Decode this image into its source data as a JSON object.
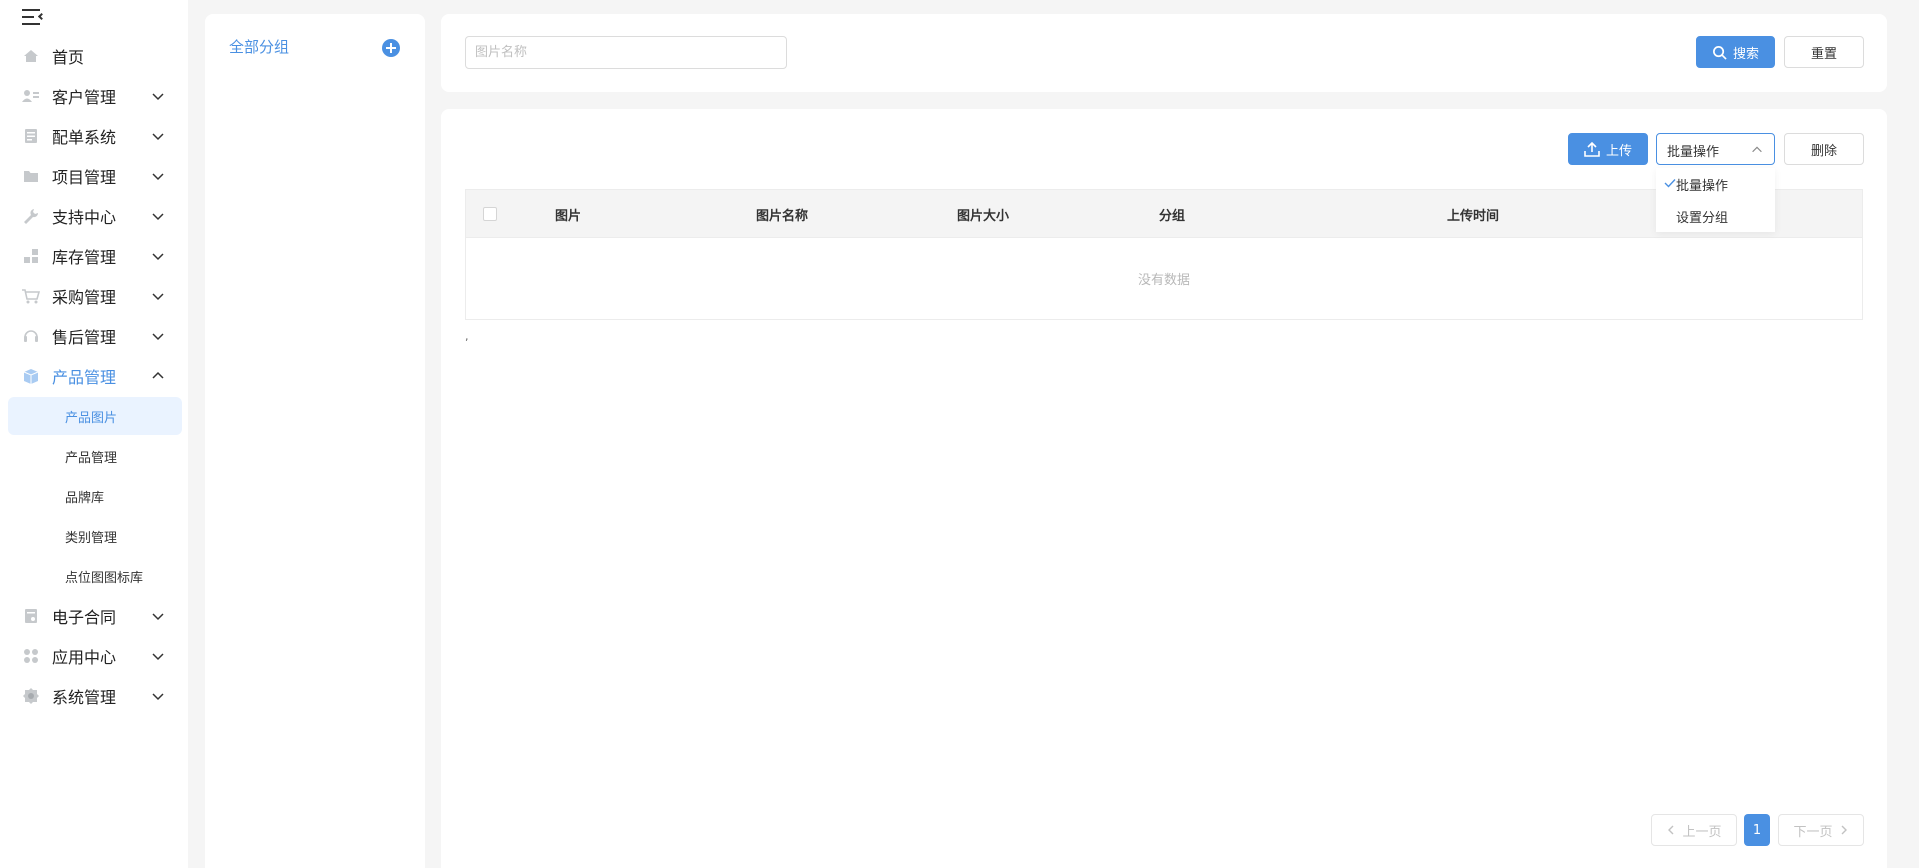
{
  "sidebar": {
    "menu": [
      {
        "label": "首页",
        "icon": "home-icon"
      },
      {
        "label": "客户管理",
        "icon": "user-card-icon"
      },
      {
        "label": "配单系统",
        "icon": "document-icon"
      },
      {
        "label": "项目管理",
        "icon": "folder-icon"
      },
      {
        "label": "支持中心",
        "icon": "wrench-icon"
      },
      {
        "label": "库存管理",
        "icon": "boxes-icon"
      },
      {
        "label": "采购管理",
        "icon": "cart-icon"
      },
      {
        "label": "售后管理",
        "icon": "headset-icon"
      },
      {
        "label": "产品管理",
        "icon": "cube-icon",
        "expanded": true
      },
      {
        "label": "电子合同",
        "icon": "contract-icon"
      },
      {
        "label": "应用中心",
        "icon": "apps-icon"
      },
      {
        "label": "系统管理",
        "icon": "gear-icon"
      }
    ],
    "product_sub": [
      {
        "label": "产品图片",
        "active": true
      },
      {
        "label": "产品管理"
      },
      {
        "label": "品牌库"
      },
      {
        "label": "类别管理"
      },
      {
        "label": "点位图图标库"
      }
    ]
  },
  "groups": {
    "title": "全部分组"
  },
  "search": {
    "placeholder": "图片名称",
    "search_label": "搜索",
    "reset_label": "重置"
  },
  "toolbar": {
    "upload_label": "上传",
    "batch_value": "批量操作",
    "batch_options": [
      "批量操作",
      "设置分组"
    ],
    "delete_label": "删除"
  },
  "table": {
    "columns": [
      "图片",
      "图片名称",
      "图片大小",
      "分组",
      "上传时间"
    ],
    "empty_text": "没有数据",
    "trailing_mark": ","
  },
  "pagination": {
    "prev": "上一页",
    "current": "1",
    "next": "下一页"
  },
  "colors": {
    "accent": "#4a90e2",
    "icon_gray": "#9aa0a6"
  }
}
